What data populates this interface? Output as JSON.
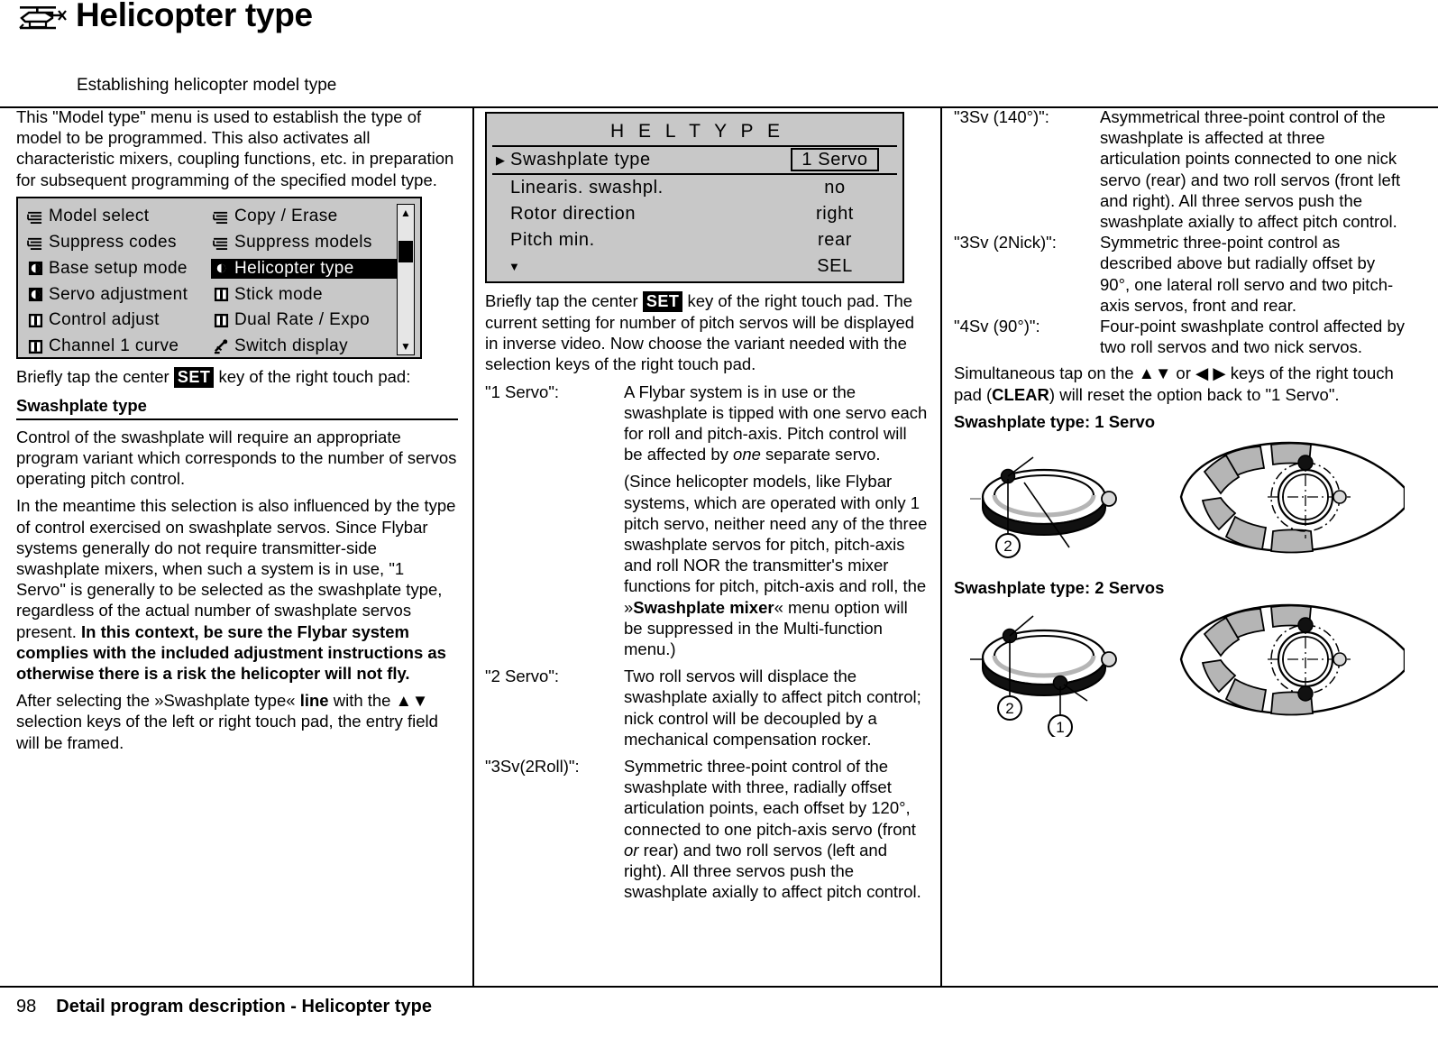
{
  "header": {
    "icon": "helicopter-icon",
    "title": "Helicopter type",
    "subtitle": "Establishing helicopter model type"
  },
  "footer": {
    "page_number": "98",
    "text": "Detail program description - Helicopter type"
  },
  "col1": {
    "intro": "This \"Model type\" menu is used to establish the type of model to be programmed. This also activates all characteristic mixers, coupling functions, etc. in preparation for subsequent programming of the specified model type.",
    "menu_screen": {
      "rows": [
        {
          "left_icon": "list-icon",
          "left": "Model select",
          "left_selected": false,
          "right_icon": "list-icon",
          "right": "Copy / Erase",
          "right_selected": false
        },
        {
          "left_icon": "list-icon",
          "left": "Suppress codes",
          "left_selected": false,
          "right_icon": "list-icon",
          "right": "Suppress models",
          "right_selected": false
        },
        {
          "left_icon": "disk-icon",
          "left": "Base setup mode",
          "left_selected": false,
          "right_icon": "disk-icon",
          "right": "Helicopter type",
          "right_selected": true
        },
        {
          "left_icon": "disk-icon",
          "left": "Servo adjustment",
          "left_selected": false,
          "right_icon": "stick-icon",
          "right": "Stick mode",
          "right_selected": false
        },
        {
          "left_icon": "stick-icon",
          "left": "Control adjust",
          "left_selected": false,
          "right_icon": "stick-icon",
          "right": "Dual Rate / Expo",
          "right_selected": false
        },
        {
          "left_icon": "stick-icon",
          "left": "Channel 1 curve",
          "left_selected": false,
          "right_icon": "switch-icon",
          "right": "Switch display",
          "right_selected": false
        }
      ],
      "scroll_up": "▲",
      "scroll_down": "▼"
    },
    "tap_set_pre": "Briefly tap the center ",
    "set_key": "SET",
    "tap_set_post": " key of the right touch pad:",
    "section_heading": "Swashplate type",
    "p1": "Control of the swashplate will require an appropriate program variant which corresponds to the number of servos operating pitch control.",
    "p2_a": "In the meantime this selection is also influenced by the type of control exercised on swashplate servos. Since Flybar systems generally do not require transmitter-side swashplate mixers, when such a system is in use, \"1 Servo\" is generally to be selected as the swashplate type, regardless of the actual number of swashplate servos present. ",
    "p2_bold": "In this context, be sure the Flybar system complies with the included adjustment instructions as otherwise there is a risk the helicopter will not fly.",
    "p3_a": "After selecting the »Swashplate type« ",
    "p3_bold": "line",
    "p3_b": " with the ",
    "p3_keys": "▲▼",
    "p3_c": " selection keys of the left or right touch pad, the entry field will be framed."
  },
  "col2": {
    "heli_screen": {
      "title": "H E L  T Y P E",
      "rows": [
        {
          "caret": "▶",
          "label": "Swashplate type",
          "value": "1 Servo",
          "framed": true
        },
        {
          "caret": "",
          "label": "Linearis. swashpl.",
          "value": "no",
          "framed": false
        },
        {
          "caret": "",
          "label": "Rotor direction",
          "value": "right",
          "framed": false
        },
        {
          "caret": "",
          "label": "Pitch min.",
          "value": "rear",
          "framed": false
        },
        {
          "caret": "▼",
          "label": "",
          "value": "SEL",
          "framed": false
        }
      ]
    },
    "tap_set_pre": "Briefly tap the center ",
    "set_key": "SET",
    "tap_set_post": " key of the right touch pad. The current setting for number of pitch servos will be displayed in inverse video. Now choose the variant needed with the selection keys of the right touch pad.",
    "definitions": [
      {
        "term": "\"1 Servo\":",
        "paras": [
          {
            "text_a": "A Flybar system is in use or the swashplate is tipped with one servo each for roll and pitch-axis. Pitch control will be affected by ",
            "em": "one",
            "text_b": " separate servo."
          },
          {
            "text_a": "(Since helicopter models, like Flybar systems, which are operated with only 1 pitch servo, neither need any of the three swashplate servos for pitch, pitch-axis and roll NOR the transmitter's mixer functions for pitch, pitch-axis and roll, the »",
            "bold": "Swashplate mixer",
            "text_b": "« menu option will be suppressed in the Multi-function menu.)"
          }
        ]
      },
      {
        "term": "\"2 Servo\":",
        "paras": [
          {
            "text_a": "Two roll servos will displace the swashplate axially to affect pitch control; nick control will be decoupled by a mechanical compensation rocker.",
            "em": "",
            "text_b": ""
          }
        ]
      },
      {
        "term": "\"3Sv(2Roll)\":",
        "paras": [
          {
            "text_a": "Symmetric three-point control of the swashplate with three, radially offset articulation points, each offset by 120°, connected to one pitch-axis servo (front ",
            "em": "or",
            "text_b": " rear) and two roll servos (left and right). All three servos push the swashplate axially to affect pitch control."
          }
        ]
      }
    ]
  },
  "col3": {
    "definitions": [
      {
        "term": "\"3Sv (140°)\":",
        "text": "Asymmetrical three-point control of the swashplate is affected at three articulation points connected to one nick servo (rear) and two roll servos (front left and right). All three servos push the swashplate axially to affect pitch control."
      },
      {
        "term": "\"3Sv (2Nick)\":",
        "text": "Symmetric three-point control as described above but radially offset by 90°, one lateral roll servo and two pitch-axis servos, front and rear."
      },
      {
        "term": "\"4Sv (90°)\":",
        "text": "Four-point swashplate control affected by two roll servos and two nick servos."
      }
    ],
    "clear_note_a": "Simultaneous tap on the ",
    "clear_keys_1": "▲▼",
    "clear_note_b": " or ",
    "clear_keys_2": "◀ ▶",
    "clear_note_c": " keys of the right touch pad (",
    "clear_bold": "CLEAR",
    "clear_note_d": ") will reset the option back to \"1 Servo\".",
    "diagram1_caption": "Swashplate type: 1 Servo",
    "diagram1_labels": [
      "2"
    ],
    "diagram2_caption": "Swashplate type: 2 Servos",
    "diagram2_labels": [
      "2",
      "1"
    ]
  },
  "colors": {
    "lcd_background": "#c8c8c8",
    "ink": "#000000",
    "page": "#ffffff",
    "diagram_fill": "#b5b5b5"
  }
}
